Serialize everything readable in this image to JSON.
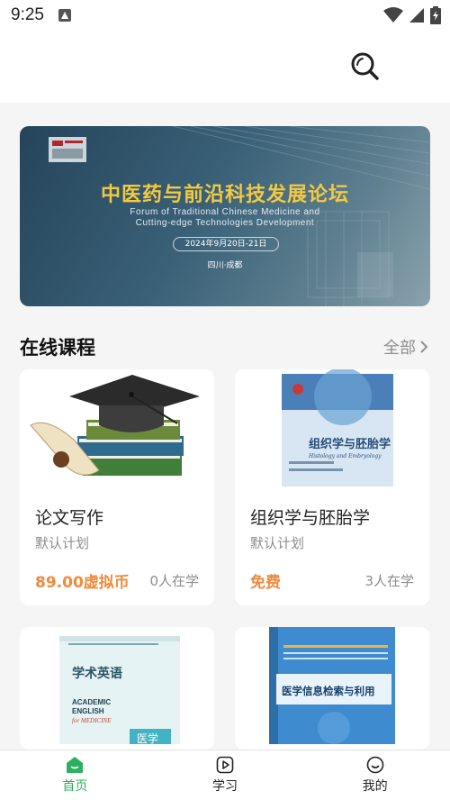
{
  "status": {
    "time": "9:25"
  },
  "banner": {
    "title": "中医药与前沿科技发展论坛",
    "subtitle_line1": "Forum of Traditional Chinese Medicine and",
    "subtitle_line2": "Cutting-edge Technologies Development",
    "date": "2024年9月20日-21日",
    "location": "四川·成都"
  },
  "section": {
    "title": "在线课程",
    "more_label": "全部"
  },
  "courses": [
    {
      "title": "论文写作",
      "plan": "默认计划",
      "price": "89.00虚拟币",
      "learners": "0人在学"
    },
    {
      "title": "组织学与胚胎学",
      "plan": "默认计划",
      "price": "免费",
      "learners": "3人在学"
    },
    {
      "title": "学术英语",
      "plan": "",
      "price": "",
      "learners": ""
    },
    {
      "title": "医学信息检索与利用",
      "plan": "",
      "price": "",
      "learners": ""
    }
  ],
  "book_covers": {
    "histology_cn": "组织学与胚胎学",
    "histology_en": "Histology and Embryology",
    "english_cn": "学术英语",
    "english_en_line1": "ACADEMIC",
    "english_en_line2": "ENGLISH",
    "english_en_line3": "for MEDICINE",
    "english_tag": "医学",
    "info_cn": "医学信息检索与利用"
  },
  "tabs": [
    {
      "label": "首页",
      "icon": "home-icon",
      "active": true
    },
    {
      "label": "学习",
      "icon": "play-icon",
      "active": false
    },
    {
      "label": "我的",
      "icon": "profile-icon",
      "active": false
    }
  ],
  "colors": {
    "accent": "#2bb05d",
    "price": "#ef8a3b",
    "banner_title": "#f3c93f"
  }
}
